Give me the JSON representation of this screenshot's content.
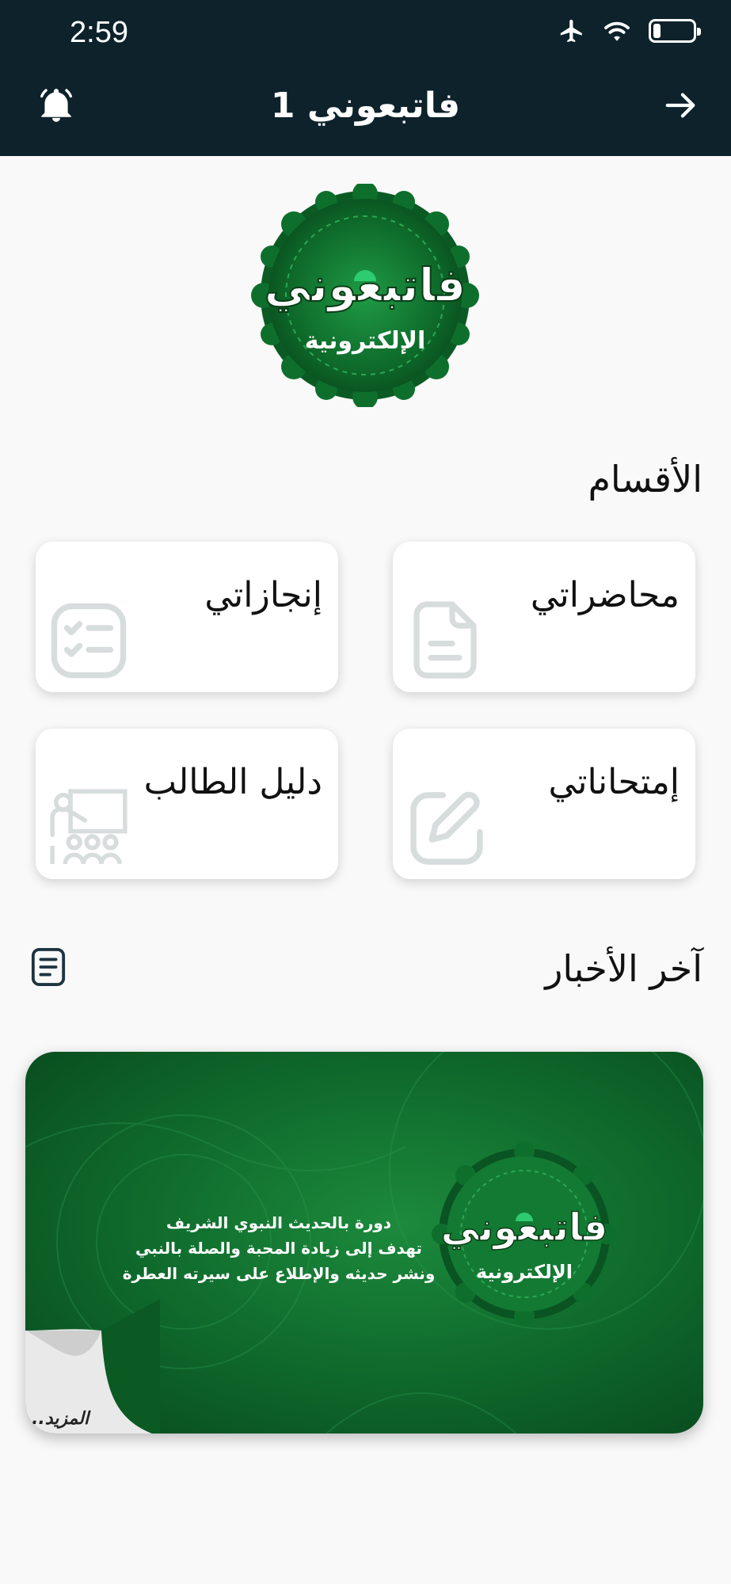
{
  "status_bar": {
    "time": "2:59",
    "icons": [
      "airplane-icon",
      "wifi-icon",
      "battery-icon"
    ]
  },
  "header": {
    "title": "فاتبعوني 1",
    "left_icon": "bell-icon",
    "right_icon": "arrow-right-icon"
  },
  "logo": {
    "title": "فاتبعوني",
    "subtitle": "الإلكترونية"
  },
  "sections": {
    "title": "الأقسام",
    "cards": [
      {
        "label": "محاضراتي",
        "icon": "document-icon"
      },
      {
        "label": "إنجازاتي",
        "icon": "checklist-icon"
      },
      {
        "label": "إمتحاناتي",
        "icon": "edit-icon"
      },
      {
        "label": "دليل الطالب",
        "icon": "classroom-icon"
      }
    ]
  },
  "news": {
    "title": "آخر الأخبار",
    "icon": "news-icon",
    "banner": {
      "line1": "دورة بالحديث النبوي الشريف",
      "line2": "تهدف إلى زيادة المحبة والصلة بالنبي",
      "line3": "ونشر حديثه والإطلاع على سيرته العطرة",
      "logo_title": "فاتبعوني",
      "logo_subtitle": "الإلكترونية",
      "more_label": "المزيد.."
    }
  },
  "colors": {
    "header_bg": "#0d222b",
    "page_bg": "#f9f9f9",
    "brand_green": "#0f6a2c",
    "icon_gray": "#d7dcdc"
  }
}
